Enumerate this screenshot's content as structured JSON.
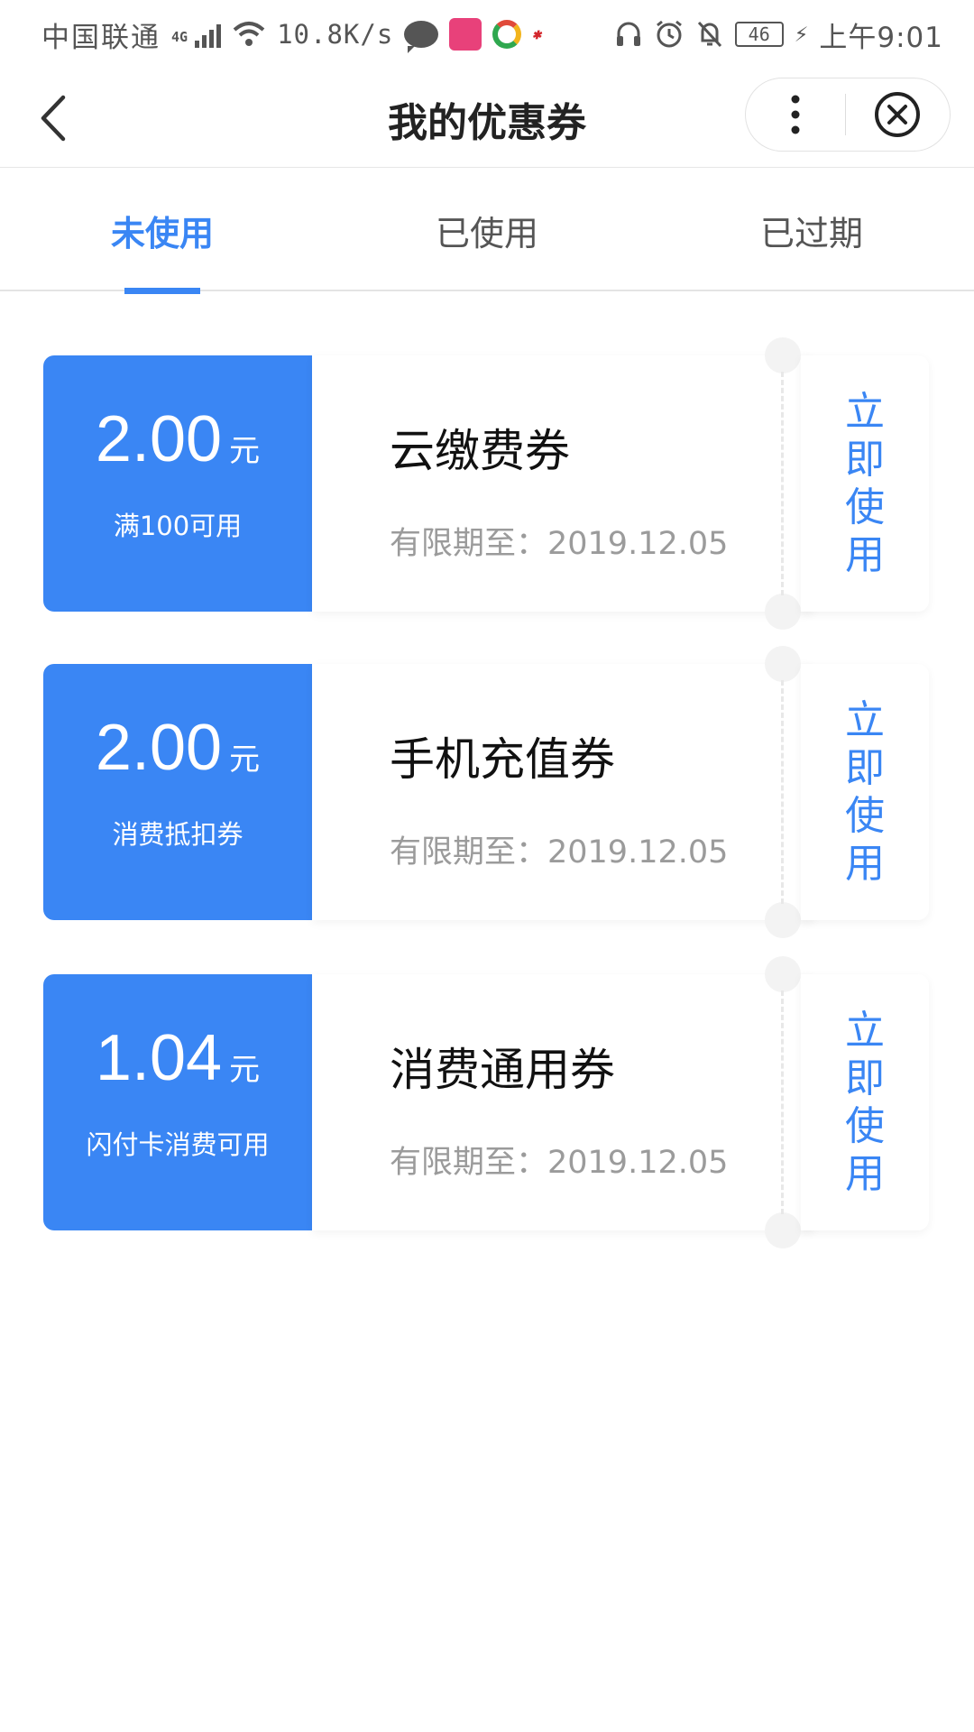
{
  "status_bar": {
    "carrier": "中国联通",
    "network_type": "4G",
    "net_speed": "10.8K/s",
    "battery_level": "46",
    "time": "上午9:01"
  },
  "nav": {
    "title": "我的优惠券"
  },
  "tabs": [
    {
      "label": "未使用",
      "active": true
    },
    {
      "label": "已使用",
      "active": false
    },
    {
      "label": "已过期",
      "active": false
    }
  ],
  "coupons": [
    {
      "amount": "2.00",
      "unit": "元",
      "condition": "满100可用",
      "name": "云缴费券",
      "expiry": "有限期至：2019.12.05",
      "action": "立即使用"
    },
    {
      "amount": "2.00",
      "unit": "元",
      "condition": "消费抵扣券",
      "name": "手机充值券",
      "expiry": "有限期至：2019.12.05",
      "action": "立即使用"
    },
    {
      "amount": "1.04",
      "unit": "元",
      "condition": "闪付卡消费可用",
      "name": "消费通用券",
      "expiry": "有限期至：2019.12.05",
      "action": "立即使用"
    }
  ],
  "colors": {
    "accent": "#3a86f4",
    "muted_text": "#9b9b9b"
  }
}
